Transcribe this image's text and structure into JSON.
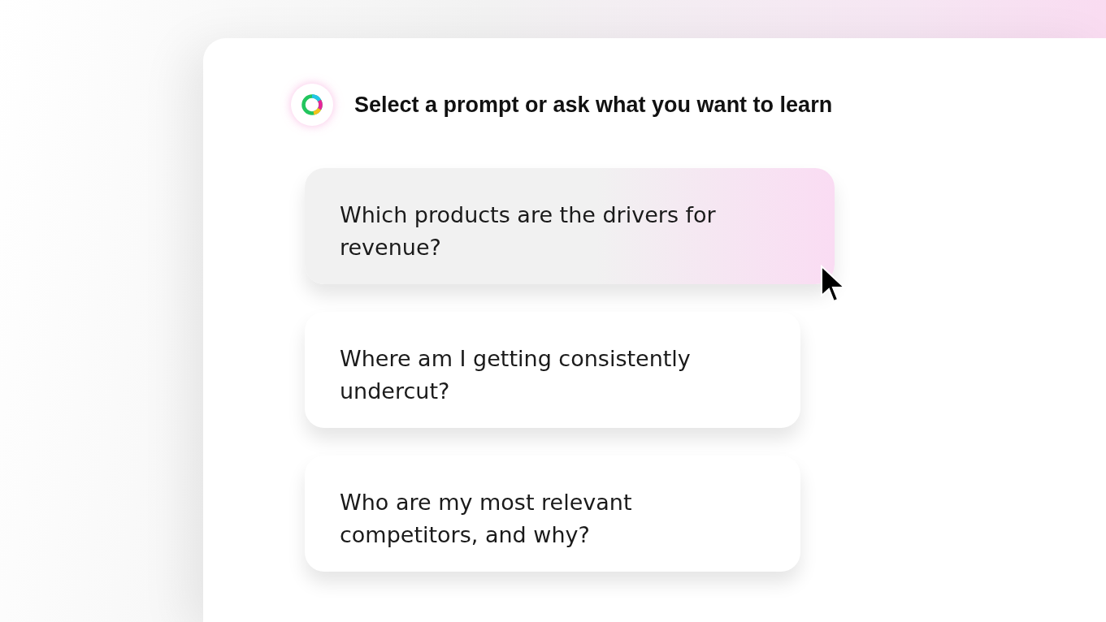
{
  "heading": "Select a prompt or ask what you want to learn",
  "prompts": [
    {
      "text": "Which products are the drivers for revenue?",
      "selected": true
    },
    {
      "text": "Where am I getting consistently undercut?",
      "selected": false
    },
    {
      "text": "Who are my most relevant competitors, and why?",
      "selected": false
    }
  ]
}
